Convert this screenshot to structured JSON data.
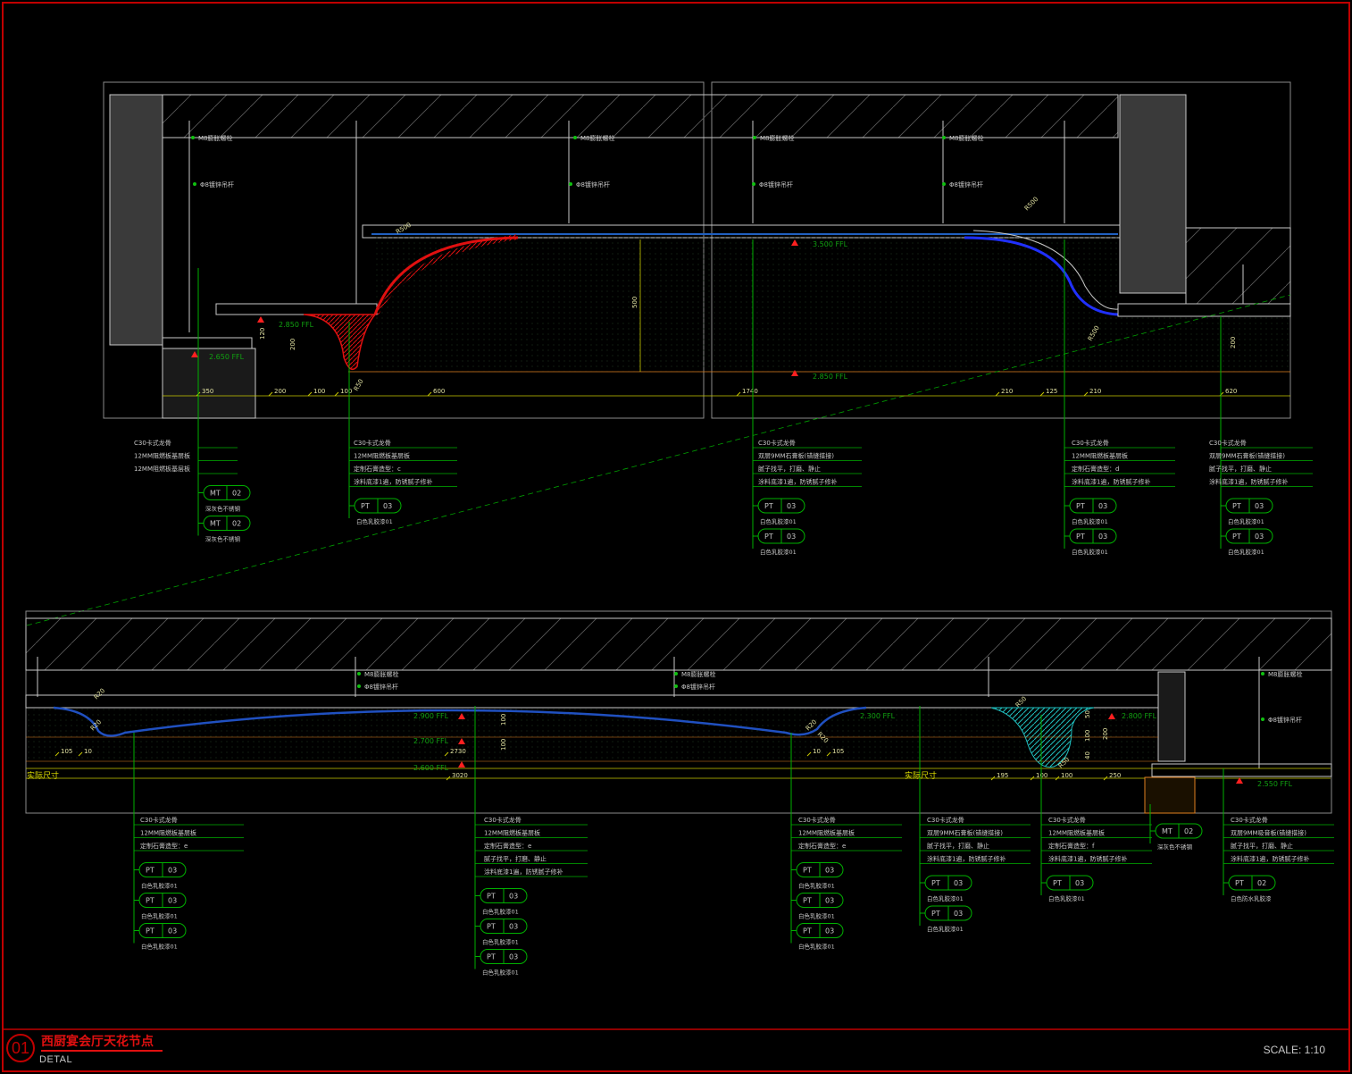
{
  "sheet": {
    "number": "01",
    "title": "西厨宴会厅天花节点",
    "subtitle": "DETAL",
    "scale": "SCALE: 1:10"
  },
  "colors": {
    "frame": "#c00000",
    "outline": "#c8c8c8",
    "dim": "#c8c800",
    "leader": "#00b000",
    "tag_text": "#c8c8c8",
    "hatch": "#606060",
    "red_fill": "#e01010",
    "blue_fill": "#2030ff",
    "cyan_hatch": "#20c0c0",
    "grey_wall": "#3a3a3a"
  },
  "top_detail": {
    "dims": [
      "350",
      "200",
      "100",
      "100",
      "600",
      "1740",
      "210",
      "125",
      "210",
      "620"
    ],
    "vertical_dims": [
      "120",
      "200",
      "500",
      "200"
    ],
    "levels": [
      "2.850 FFL",
      "2.650 FFL",
      "3.500 FFL",
      "2.850 FFL"
    ],
    "radii": [
      "R500",
      "R50",
      "R500",
      "R500"
    ],
    "hanger_notes": [
      "M8膨胀螺栓",
      "Φ8镀锌吊杆",
      "M8膨胀螺栓",
      "Φ8镀锌吊杆",
      "M8膨胀螺栓",
      "Φ8镀锌吊杆",
      "M8膨胀螺栓",
      "Φ8镀锌吊杆"
    ],
    "callouts": [
      {
        "lines": [
          "C30卡式龙骨",
          "12MM阻燃板基层板",
          "12MM阻燃板基层板"
        ],
        "tags": [
          {
            "a": "MT",
            "b": "02",
            "note": "深灰色不锈钢"
          },
          {
            "a": "MT",
            "b": "02",
            "note": "深灰色不锈钢"
          }
        ]
      },
      {
        "lines": [
          "C30卡式龙骨",
          "12MM阻燃板基层板",
          "定制石膏造型：c",
          "涂料底漆1遍，防锈腻子修补"
        ],
        "tags": [
          {
            "a": "PT",
            "b": "03",
            "note": "白色乳胶漆01"
          }
        ]
      },
      {
        "lines": [
          "C30卡式龙骨",
          "双层9MM石膏板(错缝搭接)",
          "腻子找平，打磨、静止",
          "涂料底漆1遍，防锈腻子修补"
        ],
        "tags": [
          {
            "a": "PT",
            "b": "03",
            "note": "白色乳胶漆01"
          },
          {
            "a": "PT",
            "b": "03",
            "note": "白色乳胶漆01"
          }
        ]
      },
      {
        "lines": [
          "C30卡式龙骨",
          "12MM阻燃板基层板",
          "定制石膏造型：d",
          "涂料底漆1遍，防锈腻子修补"
        ],
        "tags": [
          {
            "a": "PT",
            "b": "03",
            "note": "白色乳胶漆01"
          },
          {
            "a": "PT",
            "b": "03",
            "note": "白色乳胶漆01"
          }
        ]
      },
      {
        "lines": [
          "C30卡式龙骨",
          "双层9MM石膏板(错缝搭接)",
          "腻子找平，打磨、静止",
          "涂料底漆1遍，防锈腻子修补"
        ],
        "tags": [
          {
            "a": "PT",
            "b": "03",
            "note": "白色乳胶漆01"
          },
          {
            "a": "PT",
            "b": "03",
            "note": "白色乳胶漆01"
          }
        ]
      }
    ]
  },
  "bottom_detail": {
    "dims": [
      "105",
      "10",
      "2730",
      "10",
      "105",
      "3020",
      "195",
      "100",
      "100",
      "250"
    ],
    "vertical_dims": [
      "100",
      "100",
      "50",
      "100",
      "40",
      "200"
    ],
    "levels": [
      "2.900 FFL",
      "2.700 FFL",
      "2.600 FFL",
      "2.300 FFL",
      "2.800 FFL",
      "2.550 FFL"
    ],
    "actual_size": "实际尺寸",
    "radii": [
      "R20",
      "R20",
      "R20",
      "R20",
      "R50",
      "R50"
    ],
    "hanger_notes": [
      "M8膨胀螺栓",
      "Φ8镀锌吊杆",
      "M8膨胀螺栓",
      "Φ8镀锌吊杆",
      "M8膨胀螺栓",
      "Φ8镀锌吊杆"
    ],
    "callouts": [
      {
        "lines": [
          "C30卡式龙骨",
          "12MM阻燃板基层板",
          "定制石膏造型：e"
        ],
        "tags": [
          {
            "a": "PT",
            "b": "03",
            "note": "白色乳胶漆01"
          },
          {
            "a": "PT",
            "b": "03",
            "note": "白色乳胶漆01"
          },
          {
            "a": "PT",
            "b": "03",
            "note": "白色乳胶漆01"
          }
        ]
      },
      {
        "lines": [
          "C30卡式龙骨",
          "12MM阻燃板基层板",
          "定制石膏造型：e",
          "腻子找平，打磨、静止",
          "涂料底漆1遍，防锈腻子修补"
        ],
        "tags": [
          {
            "a": "PT",
            "b": "03",
            "note": "白色乳胶漆01"
          },
          {
            "a": "PT",
            "b": "03",
            "note": "白色乳胶漆01"
          },
          {
            "a": "PT",
            "b": "03",
            "note": "白色乳胶漆01"
          }
        ]
      },
      {
        "lines": [
          "C30卡式龙骨",
          "12MM阻燃板基层板",
          "定制石膏造型：e"
        ],
        "tags": [
          {
            "a": "PT",
            "b": "03",
            "note": "白色乳胶漆01"
          },
          {
            "a": "PT",
            "b": "03",
            "note": "白色乳胶漆01"
          },
          {
            "a": "PT",
            "b": "03",
            "note": "白色乳胶漆01"
          }
        ]
      },
      {
        "lines": [
          "C30卡式龙骨",
          "双层9MM石膏板(错缝搭接)",
          "腻子找平，打磨、静止",
          "涂料底漆1遍，防锈腻子修补"
        ],
        "tags": [
          {
            "a": "PT",
            "b": "03",
            "note": "白色乳胶漆01"
          },
          {
            "a": "PT",
            "b": "03",
            "note": "白色乳胶漆01"
          }
        ]
      },
      {
        "lines": [
          "C30卡式龙骨",
          "12MM阻燃板基层板",
          "定制石膏造型：f",
          "涂料底漆1遍，防锈腻子修补"
        ],
        "tags": [
          {
            "a": "PT",
            "b": "03",
            "note": "白色乳胶漆01"
          }
        ]
      },
      {
        "lines": [],
        "tags": [
          {
            "a": "MT",
            "b": "02",
            "note": "深灰色不锈钢"
          }
        ]
      },
      {
        "lines": [
          "C30卡式龙骨",
          "双层9MM吸音板(错缝搭接)",
          "腻子找平，打磨、静止",
          "涂料底漆1遍，防锈腻子修补"
        ],
        "tags": [
          {
            "a": "PT",
            "b": "02",
            "note": "白色防水乳胶漆"
          }
        ]
      }
    ]
  }
}
